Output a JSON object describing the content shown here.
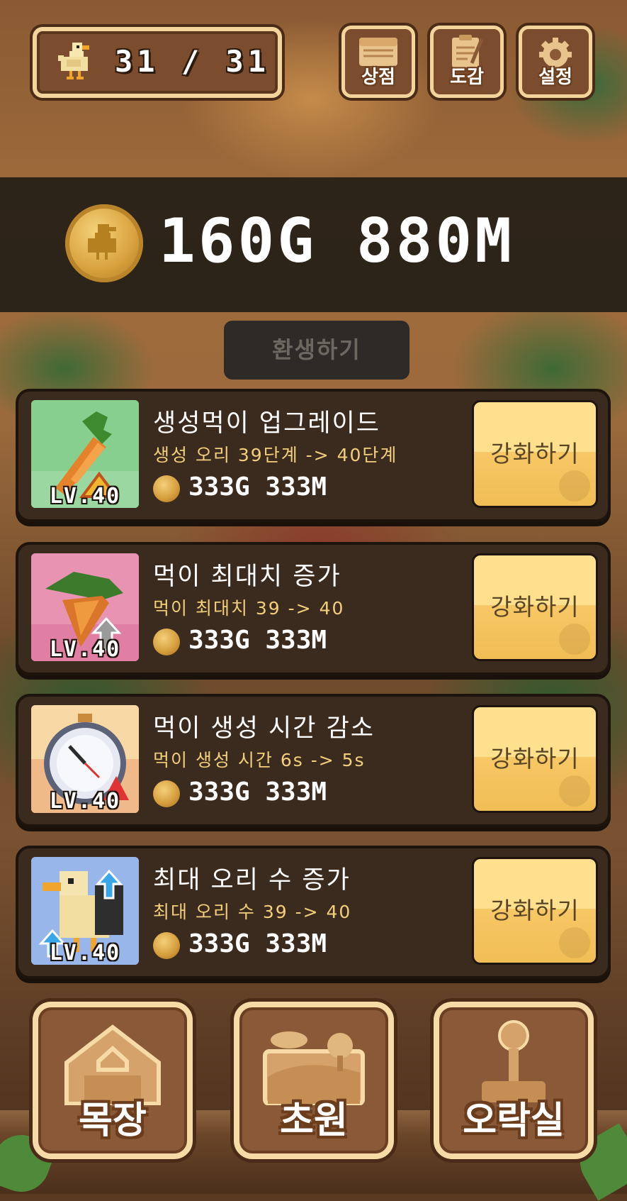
{
  "header": {
    "duck_count": "31 / 31",
    "menu": [
      {
        "label": "상점",
        "icon": "shop-icon"
      },
      {
        "label": "도감",
        "icon": "clipboard-icon"
      },
      {
        "label": "설정",
        "icon": "gear-icon"
      }
    ]
  },
  "gold": {
    "amount": "160G 880M",
    "icon": "duck-coin-icon"
  },
  "rebirth": {
    "label": "환생하기"
  },
  "upgrades": [
    {
      "title": "생성먹이 업그레이드",
      "desc": "생성 오리 39단계 -> 40단계",
      "cost": "333G 333M",
      "level": "LV.40",
      "button": "강화하기",
      "icon": "carrot-upgrade-icon"
    },
    {
      "title": "먹이 최대치 증가",
      "desc": "먹이 최대치 39 -> 40",
      "cost": "333G 333M",
      "level": "LV.40",
      "button": "강화하기",
      "icon": "carrot-bundle-icon"
    },
    {
      "title": "먹이 생성 시간 감소",
      "desc": "먹이 생성 시간 6s -> 5s",
      "cost": "333G 333M",
      "level": "LV.40",
      "button": "강화하기",
      "icon": "stopwatch-icon"
    },
    {
      "title": "최대 오리 수 증가",
      "desc": "최대 오리 수 39 -> 40",
      "cost": "333G 333M",
      "level": "LV.40",
      "button": "강화하기",
      "icon": "duck-increase-icon"
    }
  ],
  "nav": [
    {
      "label": "목장",
      "icon": "barn-icon"
    },
    {
      "label": "초원",
      "icon": "meadow-icon"
    },
    {
      "label": "오락실",
      "icon": "joystick-icon"
    }
  ],
  "colors": {
    "button_yellow": "#ffe08e",
    "card_bg": "#3b2b1e",
    "frame_cream": "#f3d49a",
    "desc_yellow": "#f2cf7c"
  }
}
